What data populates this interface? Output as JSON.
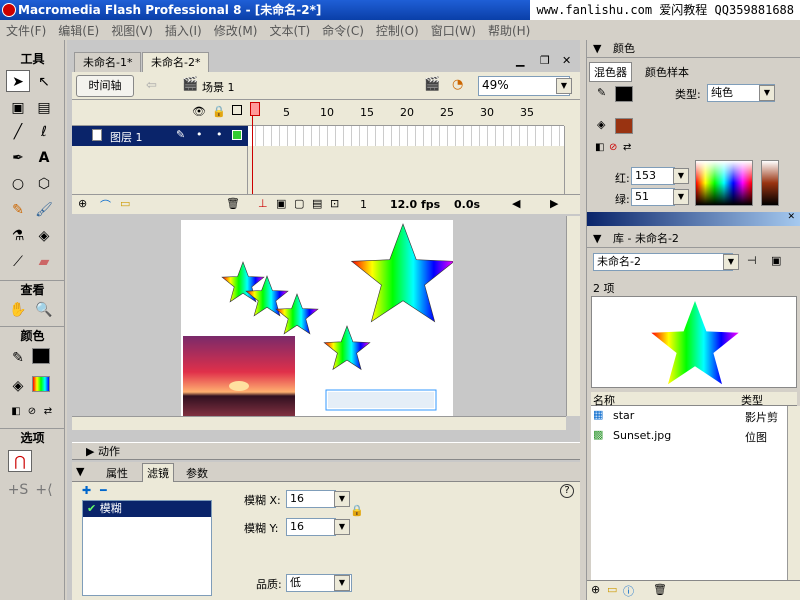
{
  "window": {
    "title": "Macromedia Flash Professional 8 - [未命名-2*]",
    "watermark": "www.fanlishu.com 爱闪教程 QQ359881688"
  },
  "menu": [
    "文件(F)",
    "编辑(E)",
    "视图(V)",
    "插入(I)",
    "修改(M)",
    "文本(T)",
    "命令(C)",
    "控制(O)",
    "窗口(W)",
    "帮助(H)"
  ],
  "toolbox": {
    "tools_label": "工具",
    "view_label": "查看",
    "colors_label": "颜色",
    "options_label": "选项"
  },
  "doc": {
    "tabs": [
      "未命名-1*",
      "未命名-2*"
    ],
    "timeline_button": "时间轴",
    "scene": "场景 1",
    "zoom": "49%"
  },
  "timeline": {
    "layer_name": "图层 1",
    "frame_numbers": [
      "1",
      "5",
      "10",
      "15",
      "20",
      "25",
      "30",
      "35"
    ],
    "current_frame": "1",
    "fps": "12.0 fps",
    "time": "0.0s"
  },
  "actions_panel": {
    "title": "动作"
  },
  "props": {
    "tabs": [
      "属性",
      "滤镜",
      "参数"
    ],
    "filter_item": "模糊",
    "blur_x_label": "模糊 X:",
    "blur_x": "16",
    "blur_y_label": "模糊 Y:",
    "blur_y": "16",
    "quality_label": "品质:",
    "quality": "低",
    "help": "?"
  },
  "color_panel": {
    "title": "颜色",
    "tabs": [
      "混色器",
      "颜色样本"
    ],
    "type_label": "类型:",
    "type": "纯色",
    "red_label": "红:",
    "red": "153",
    "green_label": "绿:",
    "green": "51",
    "stroke_color": "#000000",
    "fill_color": "#993311"
  },
  "library": {
    "title": "库 - 未命名-2",
    "doc_select": "未命名-2",
    "count": "2 项",
    "col_name": "名称",
    "col_type": "类型",
    "items": [
      {
        "name": "star",
        "type": "影片剪"
      },
      {
        "name": "Sunset.jpg",
        "type": "位图"
      }
    ]
  }
}
